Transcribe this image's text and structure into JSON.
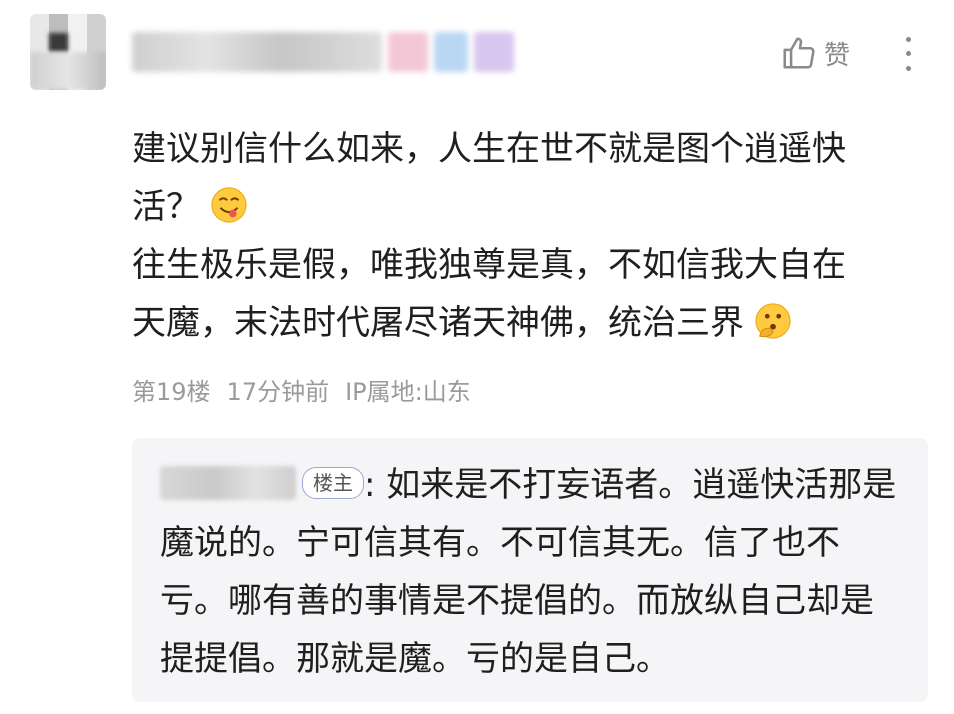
{
  "comment": {
    "lines": [
      "建议别信什么如来，人生在世不就是图个逍遥快",
      "活？",
      "往生极乐是假，唯我独尊是真，不如信我大自在",
      "天魔，末法时代屠尽诸天神佛，统治三界"
    ],
    "emoji_1": "yum-face-icon",
    "emoji_2": "thinking-face-icon"
  },
  "actions": {
    "like_label": "赞",
    "like_icon": "thumbs-up-icon",
    "more_icon": "more-vertical-icon"
  },
  "meta": {
    "floor": "第19楼",
    "time": "17分钟前",
    "ip": "IP属地:山东"
  },
  "reply": {
    "badge": "楼主",
    "colon": ":",
    "text": " 如来是不打妄语者。逍遥快活那是魔说的。宁可信其有。不可信其无。信了也不亏。哪有善的事情是不提倡的。而放纵自己却是提提倡。那就是魔。亏的是自己。"
  },
  "colors": {
    "text": "#1f1f1f",
    "meta": "#9a9a9a",
    "reply_bg": "#f5f5f7",
    "icon_gray": "#8a8a8a"
  }
}
